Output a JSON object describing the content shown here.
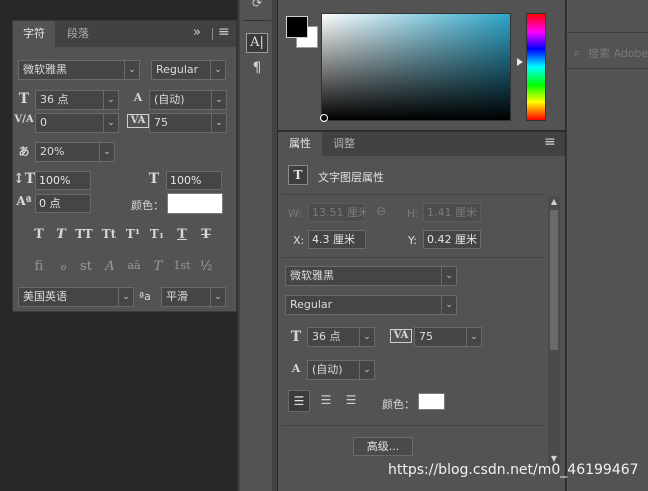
{
  "char_panel": {
    "tabs": [
      "字符",
      "段落"
    ],
    "menu_glyph": "≡",
    "collapse_glyph": "»",
    "font_family": "微软雅黑",
    "font_style": "Regular",
    "font_size": "36 点",
    "leading": "(自动)",
    "kerning": "0",
    "tracking": "75",
    "tsume": "20%",
    "vscale": "100%",
    "hscale": "100%",
    "baseline": "0 点",
    "color_label": "颜色：",
    "color_value": "#ffffff",
    "style_glyphs": [
      "T",
      "T",
      "TT",
      "Tt",
      "T¹",
      "T₁",
      "T",
      "T"
    ],
    "opentype_glyphs": [
      "fi",
      "ℴ",
      "st",
      "A",
      "aā",
      "T",
      "1st",
      "½"
    ],
    "language": "美国英语",
    "aa_icon_text": "ªa",
    "antialias": "平滑"
  },
  "properties_panel": {
    "tabs": [
      "属性",
      "调整"
    ],
    "menu_glyph": "≡",
    "section_title": "文字图层属性",
    "w_label": "W:",
    "w_value": "13.51 厘米",
    "h_label": "H:",
    "h_value": "1.41 厘米",
    "x_label": "X:",
    "x_value": "4.3 厘米",
    "y_label": "Y:",
    "y_value": "0.42 厘米",
    "font_family": "微软雅黑",
    "font_style": "Regular",
    "font_size": "36 点",
    "tracking": "75",
    "leading": "(自动)",
    "color_label": "颜色：",
    "color_value": "#ffffff",
    "advanced_button": "高级..."
  },
  "search": {
    "placeholder": "搜索 Adobe"
  },
  "watermark": "https://blog.csdn.net/m0_46199467",
  "colors": {
    "accent_hue": "#2ea6c9",
    "panel": "#535353",
    "background": "#282828"
  }
}
